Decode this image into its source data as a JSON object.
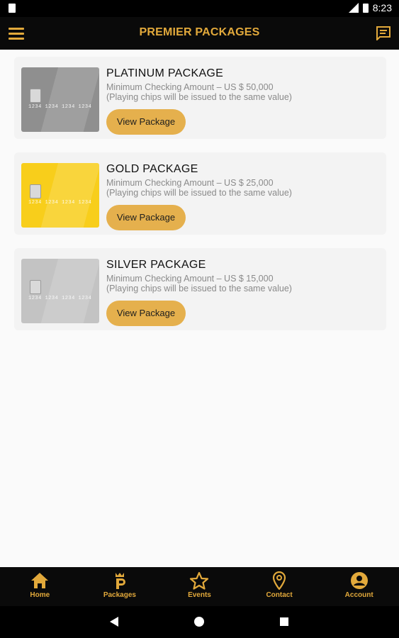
{
  "status_bar": {
    "time": "8:23"
  },
  "header": {
    "title": "PREMIER PACKAGES"
  },
  "packages": [
    {
      "title": "PLATINUM PACKAGE",
      "line1": "Minimum Checking Amount – US $ 50,000",
      "line2": "(Playing chips will be issued to the same value)",
      "button": "View Package",
      "card_color": "#8f8f8f"
    },
    {
      "title": "GOLD PACKAGE",
      "line1": "Minimum Checking Amount – US $ 25,000",
      "line2": "(Playing chips will be issued to the same value)",
      "button": "View Package",
      "card_color": "#f8ce1b"
    },
    {
      "title": "SILVER PACKAGE",
      "line1": "Minimum Checking Amount – US $ 15,000",
      "line2": "(Playing chips will be issued to the same value)",
      "button": "View Package",
      "card_color": "#c3c3c3"
    }
  ],
  "card_digits": "1234  1234  1234  1234",
  "bottom_nav": [
    {
      "label": "Home",
      "icon": "home-icon"
    },
    {
      "label": "Packages",
      "icon": "packages-icon"
    },
    {
      "label": "Events",
      "icon": "star-icon"
    },
    {
      "label": "Contact",
      "icon": "location-pin-icon"
    },
    {
      "label": "Account",
      "icon": "account-icon"
    }
  ],
  "colors": {
    "accent": "#e2a93b",
    "button": "#e5b04d",
    "bar": "#0a0a0a"
  }
}
